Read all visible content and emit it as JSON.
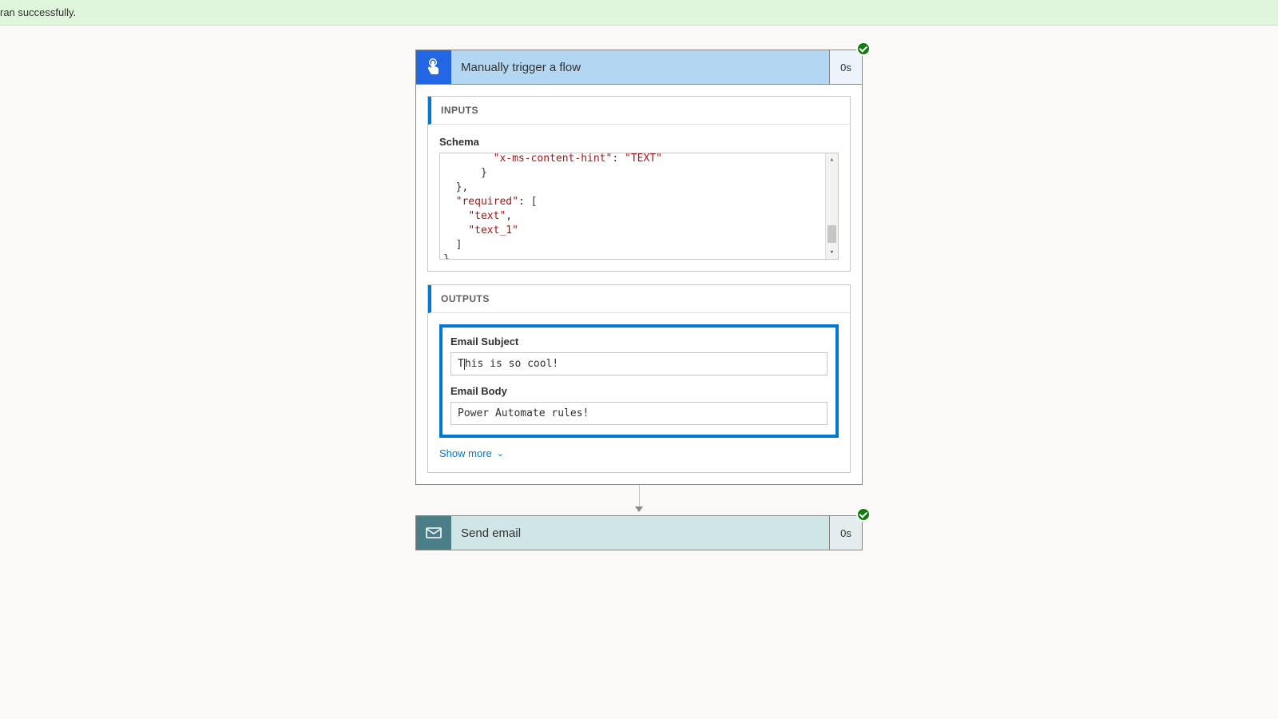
{
  "banner": {
    "text": "ran successfully."
  },
  "trigger": {
    "title": "Manually trigger a flow",
    "duration": "0s",
    "status": "success",
    "inputs": {
      "heading": "INPUTS",
      "schema_label": "Schema",
      "schema_lines": [
        "        \"x-ms-content-hint\": \"TEXT\"",
        "      }",
        "  },",
        "  \"required\": [",
        "    \"text\",",
        "    \"text_1\"",
        "  ]",
        "}"
      ]
    },
    "outputs": {
      "heading": "OUTPUTS",
      "email_subject_label": "Email Subject",
      "email_subject_value": "This is so cool!",
      "email_body_label": "Email Body",
      "email_body_value": "Power Automate rules!",
      "show_more": "Show more"
    }
  },
  "action": {
    "title": "Send email",
    "duration": "0s",
    "status": "success"
  }
}
